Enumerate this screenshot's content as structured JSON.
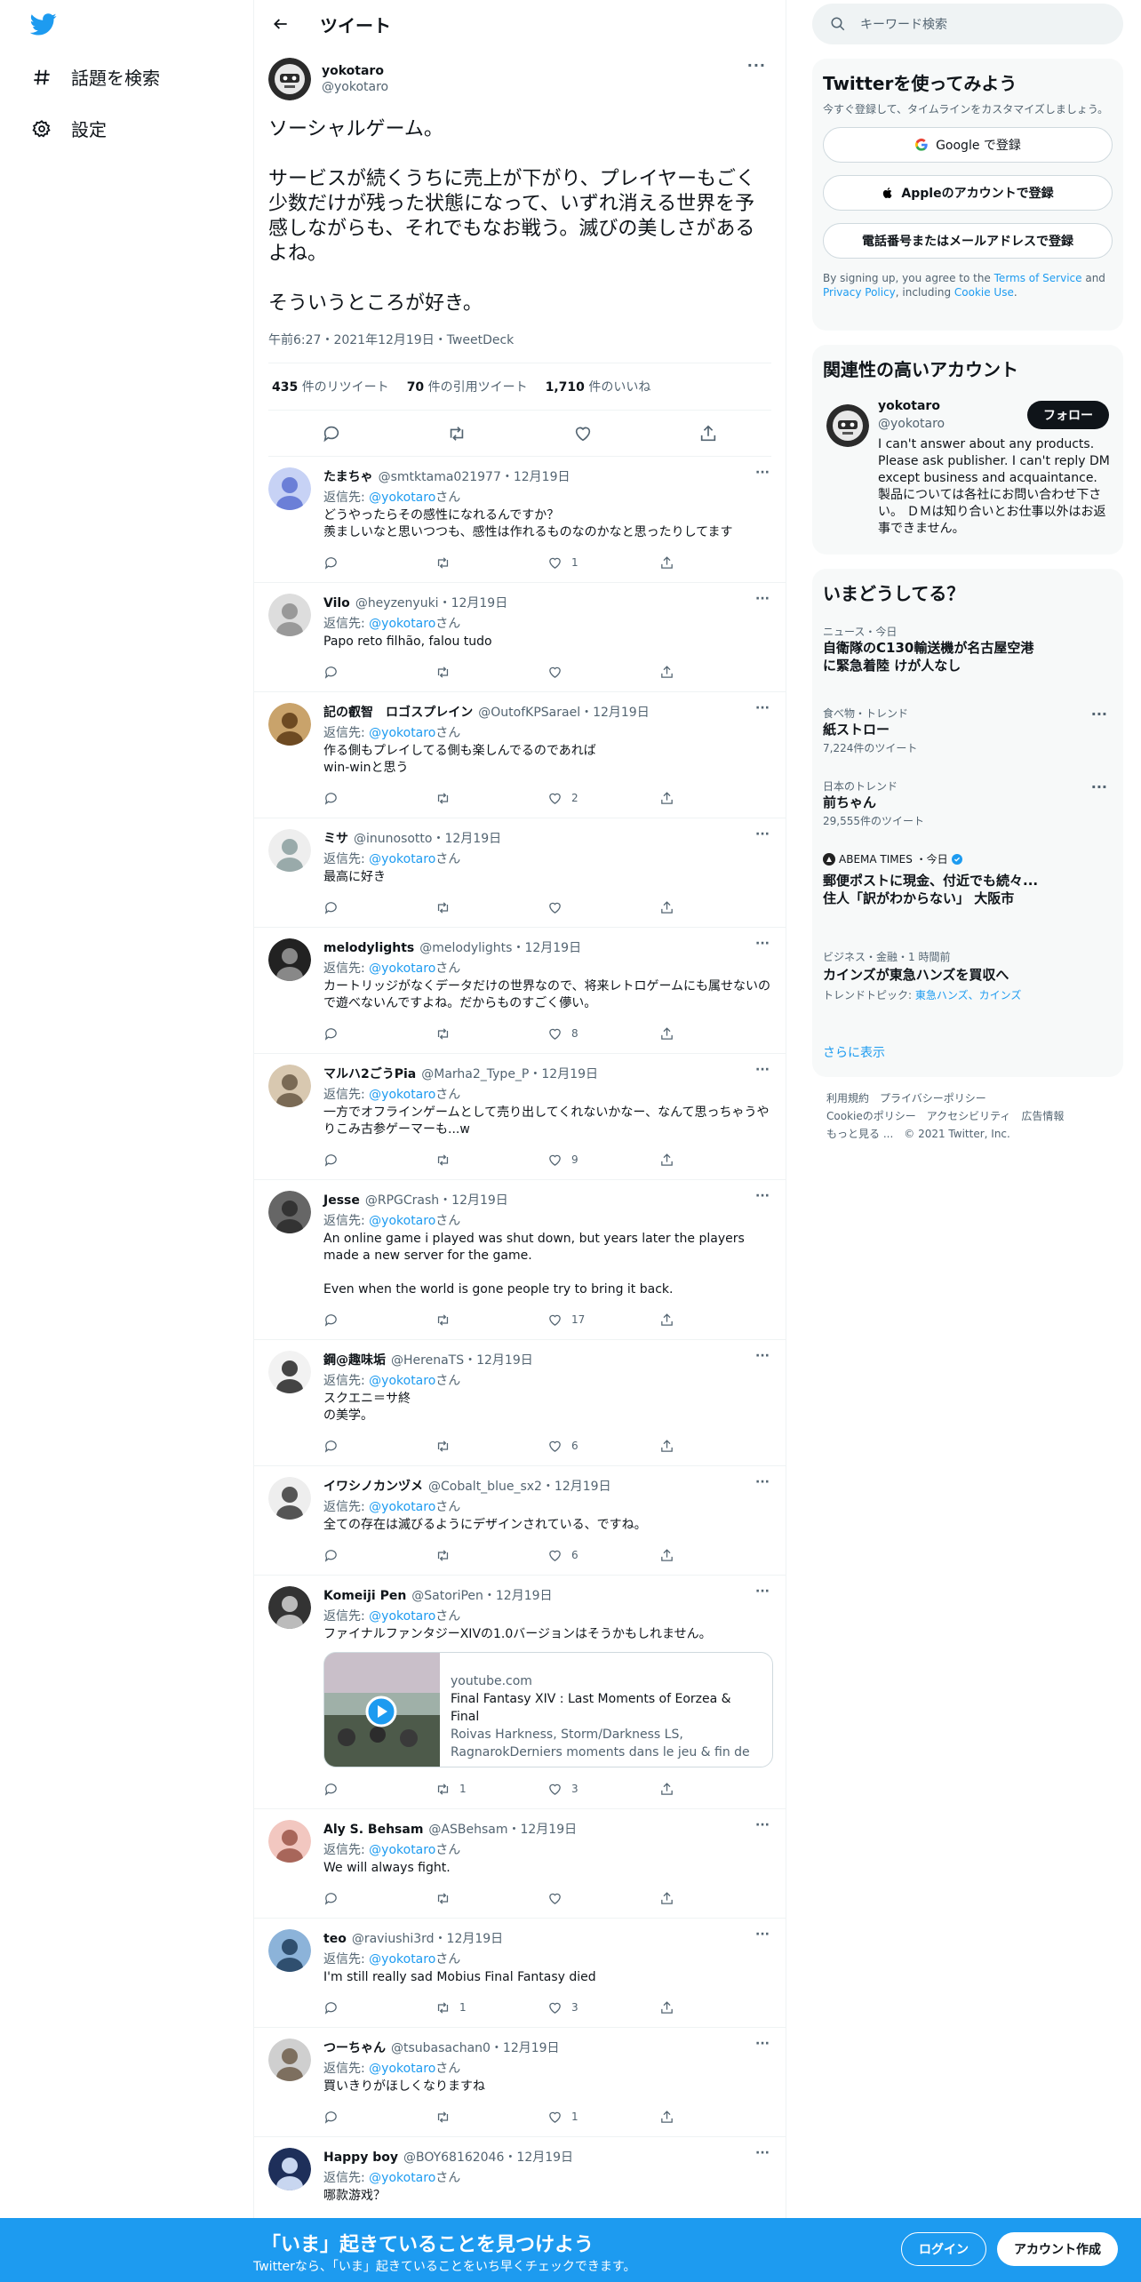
{
  "nav": {
    "explore": "話題を検索",
    "settings": "設定"
  },
  "header": {
    "title": "ツイート"
  },
  "main_tweet": {
    "name": "yokotaro",
    "handle": "@yokotaro",
    "text": "ソーシャルゲーム。\n\nサービスが続くうちに売上が下がり、プレイヤーもごく少数だけが残った状態になって、いずれ消える世界を予感しながらも、それでもなお戦う。滅びの美しさがあるよね。\n\nそういうところが好き。",
    "meta": "午前6:27・2021年12月19日・TweetDeck",
    "retweets_num": "435",
    "retweets_label": "件のリツイート",
    "quotes_num": "70",
    "quotes_label": "件の引用ツイート",
    "likes_num": "1,710",
    "likes_label": "件のいいね"
  },
  "replies": [
    {
      "name": "たまちゃ",
      "meta": "@smtktama021977・12月19日",
      "to_prefix": "返信先: ",
      "to_handle": "@yokotaro",
      "to_suffix": "さん",
      "text": "どうやったらその感性になれるんですか？\n羨ましいなと思いつつも、感性は作れるものなのかなと思ったりしてます",
      "rt": "",
      "like": "1"
    },
    {
      "name": "Vilo",
      "meta": "@heyzenyuki・12月19日",
      "to_prefix": "返信先: ",
      "to_handle": "@yokotaro",
      "to_suffix": "さん",
      "text": "Papo reto filhão, falou tudo",
      "rt": "",
      "like": ""
    },
    {
      "name": "記の叡智　ロゴスプレイン",
      "meta": "@OutofKPSarael・12月19日",
      "to_prefix": "返信先: ",
      "to_handle": "@yokotaro",
      "to_suffix": "さん",
      "text": "作る側もプレイしてる側も楽しんでるのであれば\nwin-winと思う",
      "rt": "",
      "like": "2"
    },
    {
      "name": "ミサ",
      "meta": "@inunosotto・12月19日",
      "to_prefix": "返信先: ",
      "to_handle": "@yokotaro",
      "to_suffix": "さん",
      "text": "最高に好き",
      "rt": "",
      "like": ""
    },
    {
      "name": "melodylights",
      "meta": "@melodylights・12月19日",
      "to_prefix": "返信先: ",
      "to_handle": "@yokotaro",
      "to_suffix": "さん",
      "text": "カートリッジがなくデータだけの世界なので、将来レトロゲームにも属せないので遊べないんですよね。だからものすごく儚い。",
      "rt": "",
      "like": "8"
    },
    {
      "name": "マルハ2ごうPia",
      "meta": "@Marha2_Type_P・12月19日",
      "to_prefix": "返信先: ",
      "to_handle": "@yokotaro",
      "to_suffix": "さん",
      "text": "一方でオフラインゲームとして売り出してくれないかなー、なんて思っちゃうやりこみ古参ゲーマーも...w",
      "rt": "",
      "like": "9"
    },
    {
      "name": "Jesse",
      "meta": "@RPGCrash・12月19日",
      "to_prefix": "返信先: ",
      "to_handle": "@yokotaro",
      "to_suffix": "さん",
      "text": "An online game i played was shut down, but years later the players made a new server for the game.\n\nEven when the world is gone people try to bring it back.",
      "rt": "",
      "like": "17"
    },
    {
      "name": "鋼@趣味垢",
      "meta": "@HerenaTS・12月19日",
      "to_prefix": "返信先: ",
      "to_handle": "@yokotaro",
      "to_suffix": "さん",
      "text": "スクエニ＝サ終\nの美学。",
      "rt": "",
      "like": "6"
    },
    {
      "name": "イワシノカンヅメ",
      "meta": "@Cobalt_blue_sx2・12月19日",
      "to_prefix": "返信先: ",
      "to_handle": "@yokotaro",
      "to_suffix": "さん",
      "text": "全ての存在は滅びるようにデザインされている、ですね。",
      "rt": "",
      "like": "6"
    },
    {
      "name": "Komeiji Pen",
      "meta": "@SatoriPen・12月19日",
      "to_prefix": "返信先: ",
      "to_handle": "@yokotaro",
      "to_suffix": "さん",
      "text": "ファイナルファンタジーXIVの1.0バージョンはそうかもしれません。",
      "rt": "1",
      "like": "3",
      "card": {
        "domain": "youtube.com",
        "title": "Final Fantasy XIV : Last Moments of Eorzea & Final",
        "desc": "Roivas Harkness, Storm/Darkness LS, RagnarokDerniers moments dans le jeu & fin de ..."
      }
    },
    {
      "name": "Aly S. Behsam",
      "meta": "@ASBehsam・12月19日",
      "to_prefix": "返信先: ",
      "to_handle": "@yokotaro",
      "to_suffix": "さん",
      "text": "We will always fight.",
      "rt": "",
      "like": ""
    },
    {
      "name": "teo",
      "meta": "@raviushi3rd・12月19日",
      "to_prefix": "返信先: ",
      "to_handle": "@yokotaro",
      "to_suffix": "さん",
      "text": "I'm still really sad Mobius Final Fantasy died",
      "rt": "1",
      "like": "3"
    },
    {
      "name": "つーちゃん",
      "meta": "@tsubasachan0・12月19日",
      "to_prefix": "返信先: ",
      "to_handle": "@yokotaro",
      "to_suffix": "さん",
      "text": "買いきりがほしくなりますね",
      "rt": "",
      "like": "1"
    },
    {
      "name": "Happy boy",
      "meta": "@BOY68162046・12月19日",
      "to_prefix": "返信先: ",
      "to_handle": "@yokotaro",
      "to_suffix": "さん",
      "text": "哪款游戏？",
      "rt": "",
      "like": ""
    }
  ],
  "search": {
    "placeholder": "キーワード検索"
  },
  "signup_box": {
    "title": "Twitterを使ってみよう",
    "subtitle": "今すぐ登録して、タイムラインをカスタマイズしましょう。",
    "google": "Google で登録",
    "apple": "Appleのアカウントで登録",
    "phone": "電話番号またはメールアドレスで登録",
    "terms_prefix": "By signing up, you agree to the ",
    "terms_link": "Terms of Service",
    "terms_and": " and ",
    "privacy_link": "Privacy Policy",
    "terms_including": ", including ",
    "cookie_link": "Cookie Use",
    "terms_end": "."
  },
  "related": {
    "title": "関連性の高いアカウント",
    "name": "yokotaro",
    "handle": "@yokotaro",
    "follow": "フォロー",
    "bio": "I can't answer about any products. Please ask publisher. I can't reply DM except business and acquaintance. 製品については各社にお問い合わせ下さい。 ＤＭは知り合いとお仕事以外はお返事できません。"
  },
  "trends": {
    "title": "いまどうしてる？",
    "items": [
      {
        "cat": "ニュース・今日",
        "title": "自衛隊のC130輸送機が名古屋空港に緊急着陸 けが人なし",
        "sub": ""
      },
      {
        "cat": "食べ物・トレンド",
        "title": "紙ストロー",
        "sub": "7,224件のツイート"
      },
      {
        "cat": "日本のトレンド",
        "title": "前ちゃん",
        "sub": "29,555件のツイート"
      },
      {
        "cat": "ABEMA TIMES ・今日",
        "title": "郵便ポストに現金、付近でも続々...住人「訳がわからない」 大阪市",
        "sub": ""
      },
      {
        "cat": "ビジネス・金融・1 時間前",
        "title": "カインズが東急ハンズを買収へ",
        "sub_prefix": "トレンドトピック: ",
        "sub_link": "東急ハンズ、カインズ"
      }
    ],
    "more": "さらに表示"
  },
  "footer": {
    "line1": "利用規約　プライバシーポリシー",
    "line2": "Cookieのポリシー　アクセシビリティ　広告情報",
    "line3": "もっと見る ...　© 2021 Twitter, Inc."
  },
  "bottom_bar": {
    "title": "「いま」起きていることを見つけよう",
    "subtitle": "Twitterなら、「いま」起きていることをいち早くチェックできます。",
    "login": "ログイン",
    "signup": "アカウント作成"
  },
  "colors": {
    "brand": "#1d9bf0",
    "text": "#0f1419",
    "muted": "#536471"
  }
}
